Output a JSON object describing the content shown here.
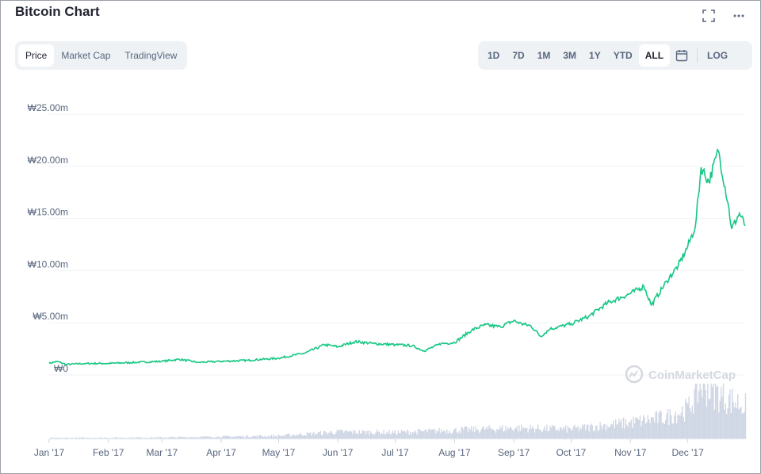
{
  "header": {
    "title": "Bitcoin Chart",
    "fullscreen_icon": "fullscreen-icon",
    "more_icon": "more-icon"
  },
  "view_tabs": {
    "items": [
      "Price",
      "Market Cap",
      "TradingView"
    ],
    "selected": "Price"
  },
  "range_tabs": {
    "items": [
      "1D",
      "7D",
      "1M",
      "3M",
      "1Y",
      "YTD",
      "ALL"
    ],
    "selected": "ALL",
    "calendar_icon": "calendar-icon",
    "log_label": "LOG"
  },
  "watermark": "CoinMarketCap",
  "colors": {
    "line": "#16c784",
    "volume": "#cfd6e4",
    "grid": "#eff2f5",
    "axis_text": "#58667e"
  },
  "chart_data": {
    "type": "line",
    "currency_prefix": "₩",
    "y_ticks": [
      "₩25.00m",
      "₩20.00m",
      "₩15.00m",
      "₩10.00m",
      "₩5.00m",
      "₩0"
    ],
    "ylim": [
      0,
      25
    ],
    "y_unit": "million KRW",
    "x_ticks": [
      "Jan '17",
      "Feb '17",
      "Mar '17",
      "Apr '17",
      "May '17",
      "Jun '17",
      "Jul '17",
      "Aug '17",
      "Sep '17",
      "Oct '17",
      "Nov '17",
      "Dec '17"
    ],
    "series": [
      {
        "x": [
          "2017-01-01",
          "2017-01-05",
          "2017-01-10",
          "2017-01-20",
          "2017-02-01",
          "2017-02-15",
          "2017-03-01",
          "2017-03-10",
          "2017-03-20",
          "2017-04-01",
          "2017-04-15",
          "2017-05-01",
          "2017-05-15",
          "2017-05-25",
          "2017-06-01",
          "2017-06-10",
          "2017-06-20",
          "2017-07-01",
          "2017-07-10",
          "2017-07-16",
          "2017-07-25",
          "2017-08-01",
          "2017-08-10",
          "2017-08-17",
          "2017-08-25",
          "2017-09-01",
          "2017-09-05",
          "2017-09-10",
          "2017-09-15",
          "2017-09-20",
          "2017-10-01",
          "2017-10-10",
          "2017-10-20",
          "2017-11-01",
          "2017-11-08",
          "2017-11-12",
          "2017-11-20",
          "2017-11-26",
          "2017-12-01",
          "2017-12-05",
          "2017-12-08",
          "2017-12-12",
          "2017-12-17",
          "2017-12-22",
          "2017-12-24",
          "2017-12-28",
          "2017-12-31"
        ],
        "values": [
          1.1,
          1.3,
          1.0,
          1.1,
          1.1,
          1.2,
          1.3,
          1.5,
          1.2,
          1.3,
          1.4,
          1.6,
          2.1,
          2.9,
          2.7,
          3.2,
          3.0,
          2.9,
          2.8,
          2.3,
          3.0,
          3.1,
          4.3,
          4.8,
          4.6,
          5.2,
          4.9,
          4.7,
          3.7,
          4.4,
          4.9,
          5.6,
          6.9,
          7.8,
          8.5,
          6.7,
          9.0,
          10.5,
          12.3,
          14.3,
          19.9,
          18.5,
          21.5,
          16.5,
          14.0,
          15.5,
          14.3
        ]
      }
    ],
    "volume_series": {
      "x": [
        "2017-01-01",
        "2017-03-01",
        "2017-05-01",
        "2017-06-01",
        "2017-07-01",
        "2017-08-01",
        "2017-09-01",
        "2017-10-01",
        "2017-11-01",
        "2017-11-20",
        "2017-12-01",
        "2017-12-08",
        "2017-12-17",
        "2017-12-22",
        "2017-12-31"
      ],
      "values": [
        0.02,
        0.03,
        0.06,
        0.13,
        0.12,
        0.16,
        0.2,
        0.18,
        0.3,
        0.4,
        0.55,
        1.0,
        0.8,
        0.72,
        0.6
      ]
    }
  }
}
